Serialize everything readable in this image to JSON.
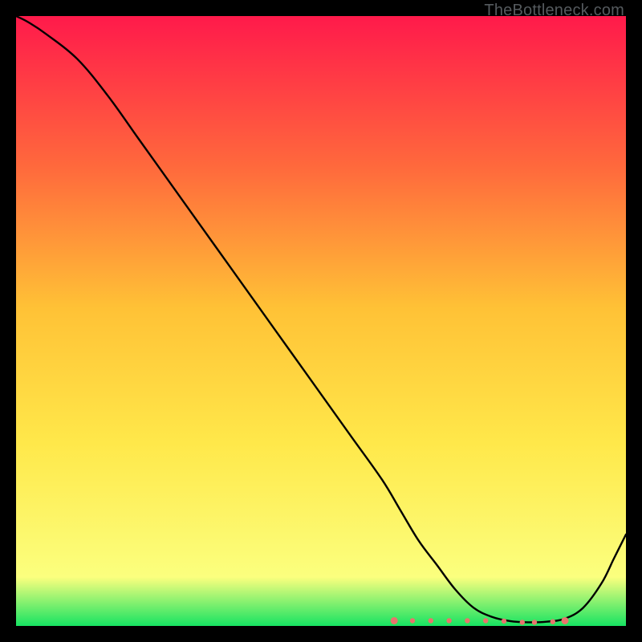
{
  "watermark": "TheBottleneck.com",
  "colors": {
    "top": "#ff1a4b",
    "mid_upper": "#ff6a3c",
    "mid": "#ffc236",
    "mid_lower": "#ffe84a",
    "low_yellow": "#fbff7e",
    "green": "#17e362",
    "curve": "#000000",
    "dots": "#e8756c"
  },
  "chart_data": {
    "type": "line",
    "title": "",
    "xlabel": "",
    "ylabel": "",
    "xlim": [
      0,
      100
    ],
    "ylim": [
      0,
      100
    ],
    "x": [
      0,
      2,
      5,
      10,
      15,
      20,
      25,
      30,
      35,
      40,
      45,
      50,
      55,
      60,
      63,
      66,
      69,
      72,
      75,
      78,
      81,
      84,
      87,
      90,
      93,
      96,
      98,
      100
    ],
    "values": [
      100,
      99,
      97,
      93,
      87,
      80,
      73,
      66,
      59,
      52,
      45,
      38,
      31,
      24,
      19,
      14,
      10,
      6,
      3,
      1.5,
      0.8,
      0.6,
      0.7,
      1.2,
      3,
      7,
      11,
      15
    ],
    "flat_region_x": [
      63,
      87
    ],
    "dot_points_x": [
      62,
      65,
      68,
      71,
      74,
      77,
      80,
      83,
      85,
      88,
      90
    ]
  }
}
